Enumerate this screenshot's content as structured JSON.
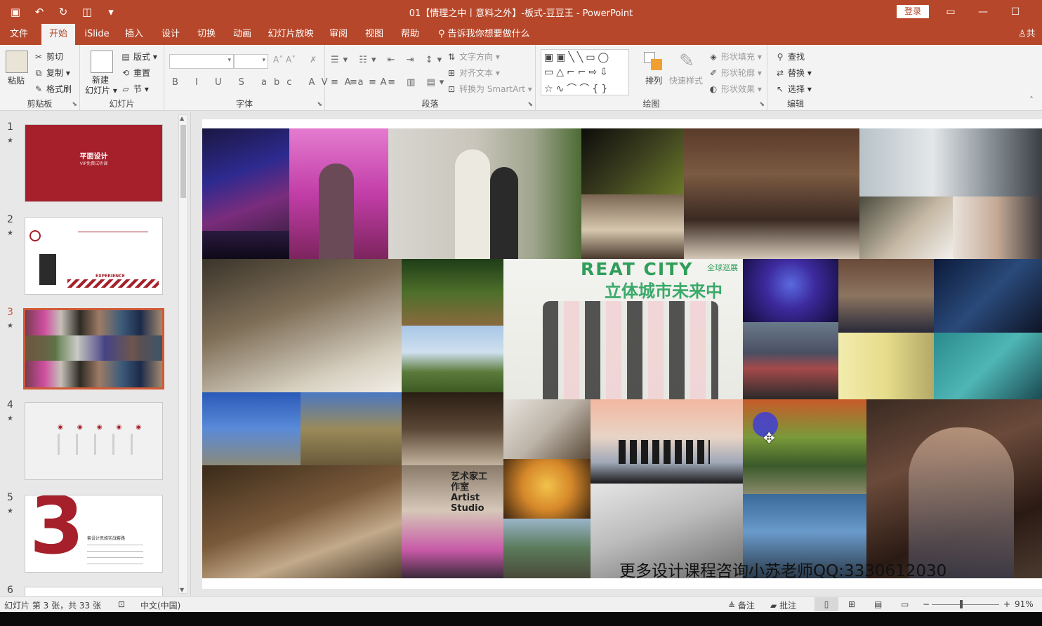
{
  "window": {
    "title": "01【情理之中丨意料之外】-板式-豆豆王 - PowerPoint",
    "login_label": "登录",
    "qat": [
      "save-icon",
      "undo-icon",
      "redo-icon",
      "present-icon",
      "customize-icon"
    ],
    "accent": "#b7472a"
  },
  "tabs": [
    {
      "label": "文件",
      "active": false
    },
    {
      "label": "开始",
      "active": true
    },
    {
      "label": "iSlide",
      "active": false
    },
    {
      "label": "插入",
      "active": false
    },
    {
      "label": "设计",
      "active": false
    },
    {
      "label": "切换",
      "active": false
    },
    {
      "label": "动画",
      "active": false
    },
    {
      "label": "幻灯片放映",
      "active": false
    },
    {
      "label": "审阅",
      "active": false
    },
    {
      "label": "视图",
      "active": false
    },
    {
      "label": "帮助",
      "active": false
    }
  ],
  "tell_me": "告诉我你想要做什么",
  "share": "共享",
  "ribbon": {
    "clipboard": {
      "label": "剪贴板",
      "paste": "粘贴",
      "cut": "剪切",
      "copy": "复制",
      "format_painter": "格式刷"
    },
    "slides": {
      "label": "幻灯片",
      "new_slide_1": "新建",
      "new_slide_2": "幻灯片",
      "layout": "版式",
      "reset": "重置",
      "section": "节"
    },
    "font": {
      "label": "字体"
    },
    "paragraph": {
      "label": "段落",
      "text_direction": "文字方向",
      "align_text": "对齐文本",
      "smartart": "转换为 SmartArt"
    },
    "drawing": {
      "label": "绘图",
      "arrange": "排列",
      "quick_styles": "快速样式",
      "shape_fill": "形状填充",
      "shape_outline": "形状轮廓",
      "shape_effects": "形状效果"
    },
    "editing": {
      "label": "编辑",
      "find": "查找",
      "replace": "替换",
      "select": "选择"
    }
  },
  "thumbnails": [
    {
      "num": "1",
      "title": "平面设计",
      "subtitle": "VIP免费试听课",
      "color": "#a5202a"
    },
    {
      "num": "2",
      "caption": "EXPERIENCE",
      "color": "#ffffff"
    },
    {
      "num": "3",
      "selected": true,
      "color": "#222222"
    },
    {
      "num": "4",
      "color": "#f1f1f1"
    },
    {
      "num": "5",
      "big_digit": "3",
      "heading": "套设计思维实战套路",
      "color": "#ffffff"
    },
    {
      "num": "6",
      "color": "#ffffff"
    }
  ],
  "slide": {
    "watermark": "更多设计课程咨询小苏老师QQ:3330612030",
    "sign_text": "REAT CITY",
    "sign_sub": "立体城市未来中",
    "sign_tag": "全球巡展",
    "studio_text": "艺术家工作室 Artist Studio"
  },
  "status": {
    "slide_info": "幻灯片 第 3 张，共 33 张",
    "language": "中文(中国)",
    "notes": "备注",
    "comments": "批注",
    "zoom": "91%"
  }
}
